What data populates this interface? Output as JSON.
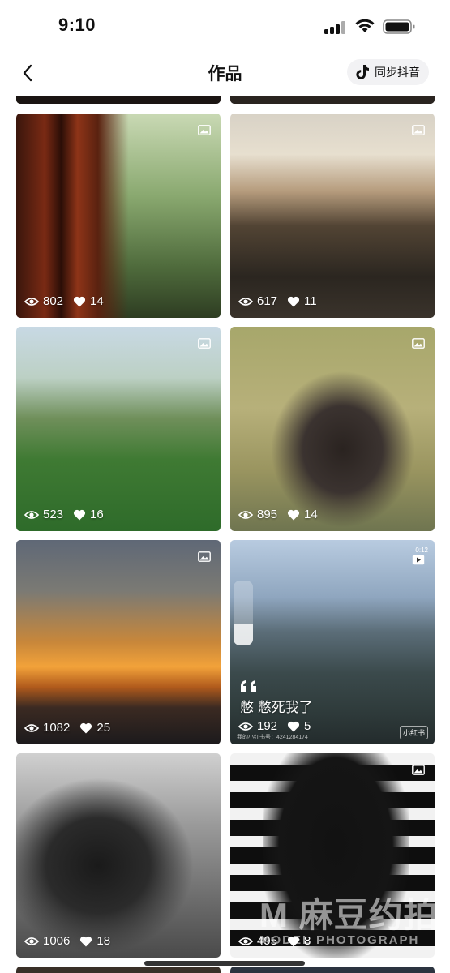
{
  "status_bar": {
    "time": "9:10"
  },
  "nav": {
    "title": "作品",
    "sync_label": "同步抖音"
  },
  "posts": [
    {
      "views": "802",
      "likes": "14",
      "type_icon": "image-icon"
    },
    {
      "views": "617",
      "likes": "11",
      "type_icon": "image-icon"
    },
    {
      "views": "523",
      "likes": "16",
      "type_icon": "image-icon"
    },
    {
      "views": "895",
      "likes": "14",
      "type_icon": "image-icon"
    },
    {
      "views": "1082",
      "likes": "25",
      "type_icon": "image-icon"
    },
    {
      "views": "192",
      "likes": "5",
      "type_icon": "video-icon",
      "caption": "憋 憋死我了",
      "watermark": "小红书",
      "duration": "0:12",
      "small_id": "我的小红书号：4241284174"
    },
    {
      "views": "1006",
      "likes": "18",
      "type_icon": "image-icon"
    },
    {
      "views": "495",
      "likes": "8",
      "type_icon": "image-icon"
    }
  ],
  "overlay_watermark": {
    "main": "M 麻豆约拍",
    "sub": "MODEL PHOTOGRAPH"
  },
  "colors": {
    "accent": "#111111",
    "sync_bg": "#f2f2f4"
  }
}
